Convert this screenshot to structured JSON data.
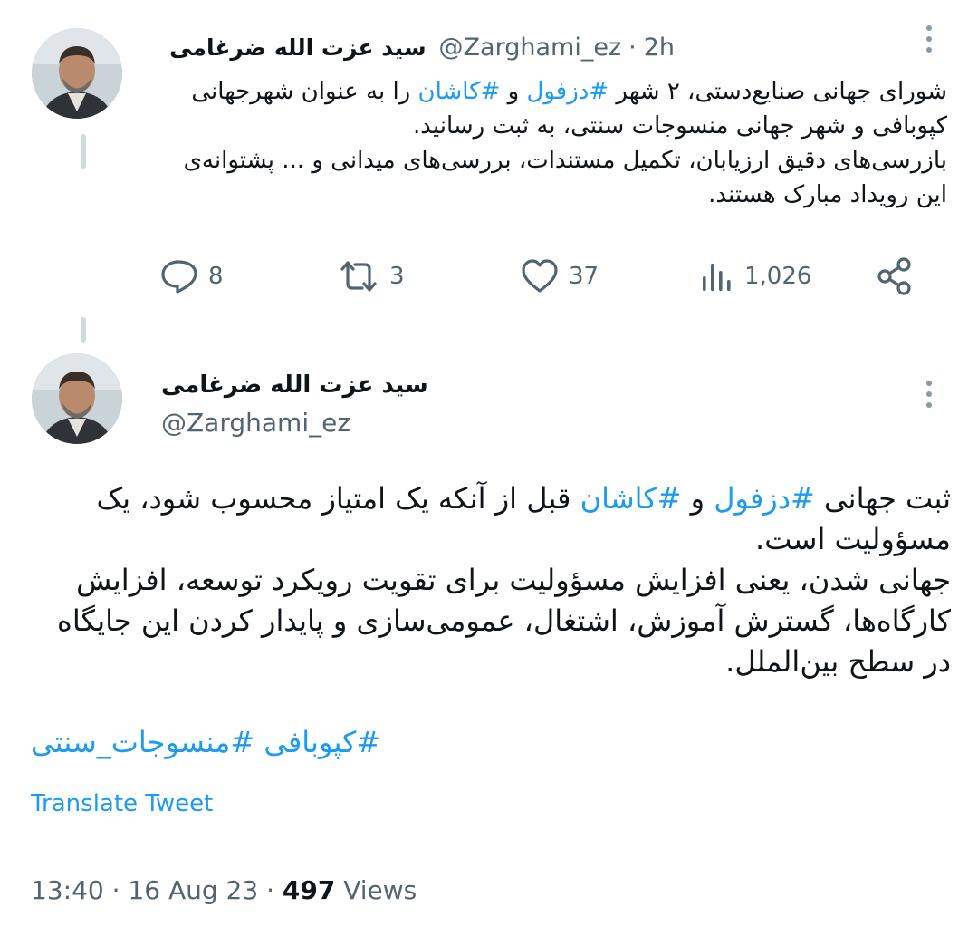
{
  "tweet1": {
    "author_name": "سید عزت الله ضرغامی",
    "handle": "@Zarghami_ez",
    "separator": "·",
    "time": "2h",
    "text_line1_a": "شورای جهانی صنایع‌دستی، ۲ شهر ",
    "hashtag1": "#دزفول",
    "text_line1_b": " و ",
    "hashtag2": "#کاشان",
    "text_line1_c": " را به عنوان شهرجهانی کپوبافی و شهر جهانی منسوجات سنتی، به ثبت رسانید.",
    "text_line2": "بازرسی‌های دقیق ارزیابان، تکمیل مستندات، بررسی‌های میدانی و ... پشتوانه‌ی این رویداد مبارک هستند.",
    "replies": "8",
    "retweets": "3",
    "likes": "37",
    "views": "1,026"
  },
  "tweet2": {
    "author_name": "سید عزت الله ضرغامی",
    "handle": "@Zarghami_ez",
    "p1_a": "ثبت جهانی ",
    "hashtag1": "#دزفول",
    "p1_b": " و ",
    "hashtag2": "#کاشان",
    "p1_c": " قبل از آنکه یک امتیاز محسوب شود، یک مسؤولیت است.",
    "p2": "جهانی شدن، یعنی افزایش مسؤولیت برای تقویت رویکرد توسعه، افزایش کارگاه‌ها، گسترش آموزش، اشتغال، عمومی‌سازی و پایدار کردن این جایگاه در سطح بین‌الملل.",
    "tags_line": "#کپوبافی #منسوجات_سنتی",
    "translate_label": "Translate Tweet",
    "time": "13:40",
    "separator": "·",
    "date": "16 Aug 23",
    "view_count": "497",
    "views_label": "Views"
  },
  "icons": {
    "reply": "reply-icon",
    "retweet": "retweet-icon",
    "like": "heart-icon",
    "views": "views-icon",
    "share": "share-icon",
    "more": "more-icon"
  },
  "colors": {
    "accent": "#1d9bf0",
    "secondary_text": "#536471",
    "thread_line": "#cfd9de"
  }
}
